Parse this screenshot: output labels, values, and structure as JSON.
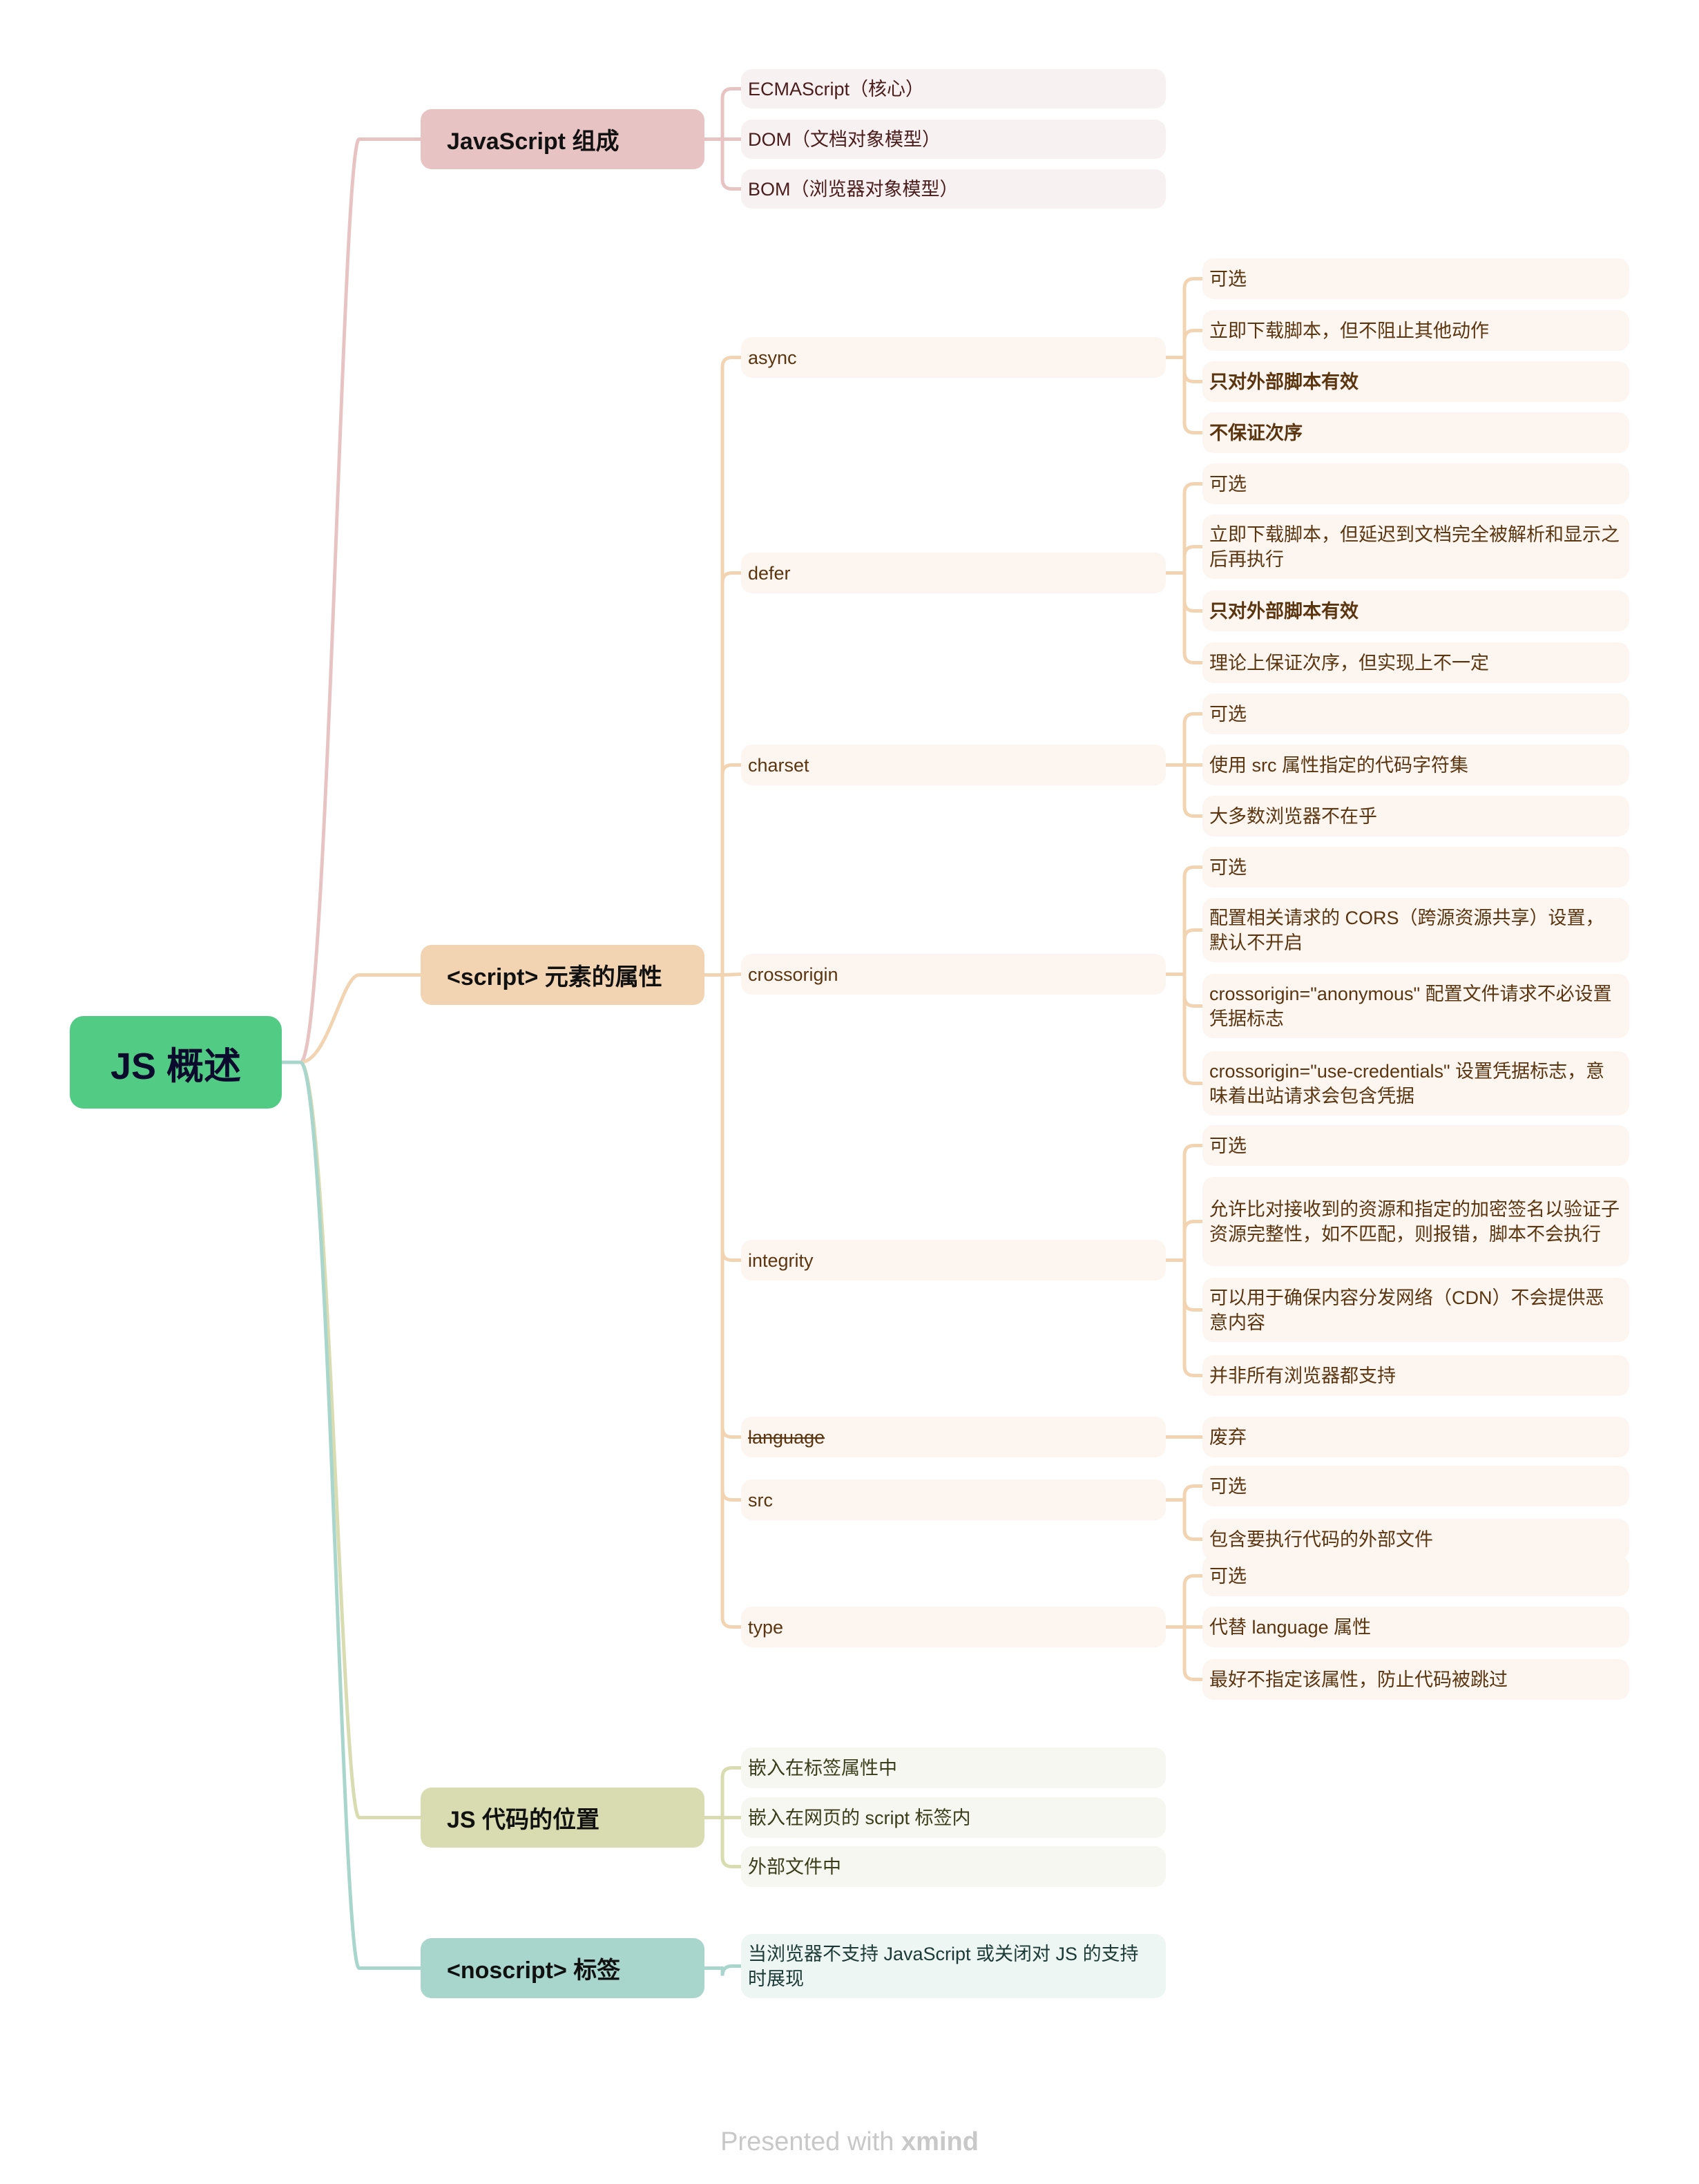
{
  "root": {
    "label": "JS 概述",
    "color": "#52cc84"
  },
  "branches": [
    {
      "label": "JavaScript 组成",
      "color": "#e8c3c3",
      "leaf_bg": "#f8f1f1",
      "line_color": "#e8c3c3",
      "text_color": "#4a1c1c",
      "children": [
        {
          "label": "ECMAScript（核心）"
        },
        {
          "label": "DOM（文档对象模型）"
        },
        {
          "label": "BOM（浏览器对象模型）"
        }
      ]
    },
    {
      "label": "<script> 元素的属性",
      "color": "#f2d4b2",
      "leaf_bg": "#fdf6f0",
      "line_color": "#f2d4b2",
      "text_color": "#5a3510",
      "children": [
        {
          "label": "async",
          "children": [
            {
              "label": "可选"
            },
            {
              "label": "立即下载脚本，但不阻止其他动作"
            },
            {
              "label": "只对外部脚本有效",
              "bold": true
            },
            {
              "label": "不保证次序",
              "bold": true
            }
          ]
        },
        {
          "label": "defer",
          "children": [
            {
              "label": "可选"
            },
            {
              "label": "立即下载脚本，但延迟到文档完全被解析和显示之后再执行"
            },
            {
              "label": "只对外部脚本有效",
              "bold": true
            },
            {
              "label": "理论上保证次序，但实现上不一定"
            }
          ]
        },
        {
          "label": "charset",
          "children": [
            {
              "label": "可选"
            },
            {
              "label": "使用 src 属性指定的代码字符集"
            },
            {
              "label": "大多数浏览器不在乎"
            }
          ]
        },
        {
          "label": "crossorigin",
          "children": [
            {
              "label": "可选"
            },
            {
              "label": "配置相关请求的 CORS（跨源资源共享）设置，默认不开启"
            },
            {
              "label": "crossorigin=\"anonymous\" 配置文件请求不必设置凭据标志"
            },
            {
              "label": "crossorigin=\"use-credentials\" 设置凭据标志，意味着出站请求会包含凭据"
            }
          ]
        },
        {
          "label": "integrity",
          "children": [
            {
              "label": "可选"
            },
            {
              "label": "允许比对接收到的资源和指定的加密签名以验证子资源完整性，如不匹配，则报错，脚本不会执行"
            },
            {
              "label": "可以用于确保内容分发网络（CDN）不会提供恶意内容"
            },
            {
              "label": "并非所有浏览器都支持"
            }
          ]
        },
        {
          "label": "language",
          "strikethrough": true,
          "children": [
            {
              "label": "废弃"
            }
          ]
        },
        {
          "label": "src",
          "children": [
            {
              "label": "可选"
            },
            {
              "label": "包含要执行代码的外部文件"
            }
          ]
        },
        {
          "label": "type",
          "children": [
            {
              "label": "可选"
            },
            {
              "label": "代替 language 属性"
            },
            {
              "label": "最好不指定该属性，防止代码被跳过"
            }
          ]
        }
      ]
    },
    {
      "label": "JS 代码的位置",
      "color": "#d9dbb0",
      "leaf_bg": "#f6f7f0",
      "line_color": "#d9dbb0",
      "text_color": "#3a3d1a",
      "children": [
        {
          "label": "嵌入在标签属性中"
        },
        {
          "label": "嵌入在网页的 script 标签内"
        },
        {
          "label": "外部文件中"
        }
      ]
    },
    {
      "label": "<noscript> 标签",
      "color": "#a8d5cc",
      "leaf_bg": "#eef6f4",
      "line_color": "#a8d5cc",
      "text_color": "#1c3a35",
      "children": [
        {
          "label": "当浏览器不支持 JavaScript 或关闭对 JS 的支持时展现"
        }
      ]
    }
  ],
  "footer": {
    "prefix": "Presented with",
    "brand": "xmind"
  }
}
